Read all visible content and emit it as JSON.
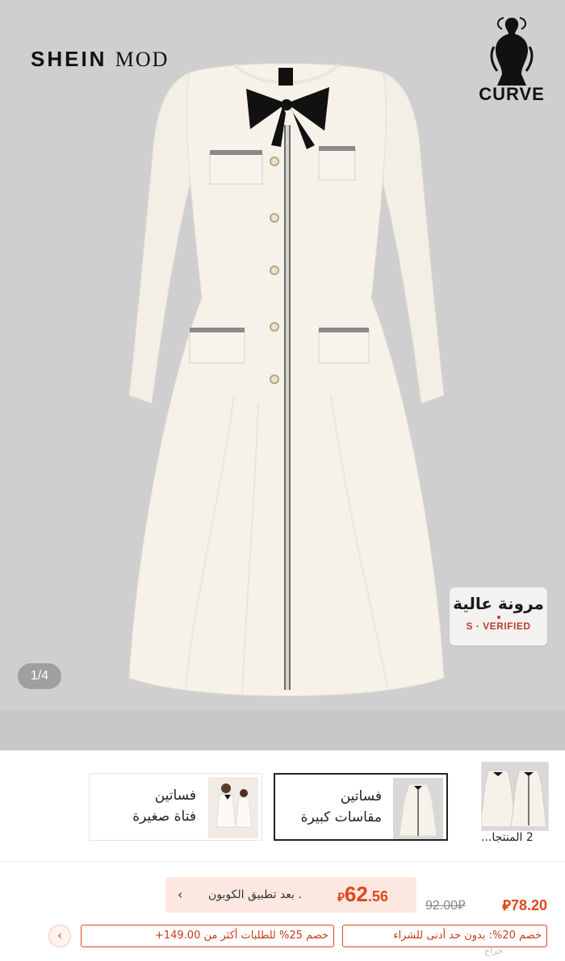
{
  "hero": {
    "brand_logo_main": "SHEIN",
    "brand_logo_sub": "MOD",
    "curve_label": "CURVE",
    "badge_arabic": "مرونة عالية",
    "badge_verified": "S · VERIFIED",
    "pager": "1/4"
  },
  "categories": [
    {
      "line1": "فساتين",
      "line2": "فتاة صغيرة"
    },
    {
      "line1": "فساتين",
      "line2": "مقاسات كبيرة"
    }
  ],
  "variant_label": "2 المنتجا...",
  "price": {
    "current": "78.20",
    "old": "92.00",
    "coupon_price_int": "62",
    "coupon_price_dec": ".56",
    "coupon_text": ". بعد تطبيق الكوبون",
    "coupon_arrow": "‹",
    "promo_1": "خصم 20%: بدون حد أدنى للشراء",
    "promo_2": "خصم 25% للطلبات أكثر من 149.00+",
    "promo_more": "‹",
    "currency_symbol": "⃁",
    "accent_color": "#e0461c"
  },
  "watermark": "حراج"
}
